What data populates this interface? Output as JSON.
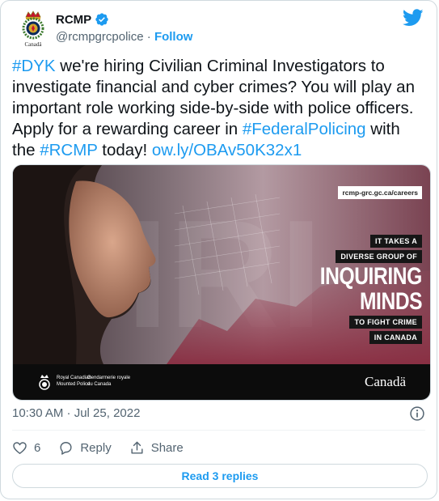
{
  "author": {
    "name": "RCMP",
    "handle": "@rcmpgrcpolice",
    "separator": "·",
    "follow_label": "Follow"
  },
  "tweet": {
    "segments": [
      {
        "text": "#DYK",
        "type": "hashtag"
      },
      {
        "text": " we're hiring Civilian Criminal Investigators to investigate financial and cyber crimes? You will play an important role working side-by-side with police officers. Apply for a rewarding career in ",
        "type": "text"
      },
      {
        "text": "#FederalPolicing",
        "type": "hashtag"
      },
      {
        "text": " with the ",
        "type": "text"
      },
      {
        "text": "#RCMP",
        "type": "hashtag"
      },
      {
        "text": " today! ",
        "type": "text"
      },
      {
        "text": "ow.ly/OBAv50K32x1",
        "type": "link"
      }
    ]
  },
  "image": {
    "url_label": "rcmp-grc.gc.ca/careers",
    "line1": "IT TAKES A",
    "line2": "DIVERSE GROUP OF",
    "big1": "INQUIRING",
    "big2": "MINDS",
    "line3": "TO FIGHT CRIME",
    "line4": "IN CANADA",
    "gov_en1": "Royal Canadian",
    "gov_en2": "Mounted Police",
    "gov_fr1": "Gendarmerie royale",
    "gov_fr2": "du Canada",
    "wordmark": "Canadä",
    "avatar_caption": "Canadä"
  },
  "meta": {
    "timestamp": "10:30 AM · Jul 25, 2022"
  },
  "actions": {
    "like_count": "6",
    "reply_label": "Reply",
    "share_label": "Share"
  },
  "replies_button": "Read 3 replies",
  "colors": {
    "accent": "#1d9bf0",
    "text": "#0f1419",
    "muted": "#536471",
    "border": "#cfd9de"
  },
  "icons": [
    "verified-badge-icon",
    "twitter-bird-icon",
    "info-icon",
    "heart-icon",
    "reply-bubble-icon",
    "share-icon"
  ]
}
